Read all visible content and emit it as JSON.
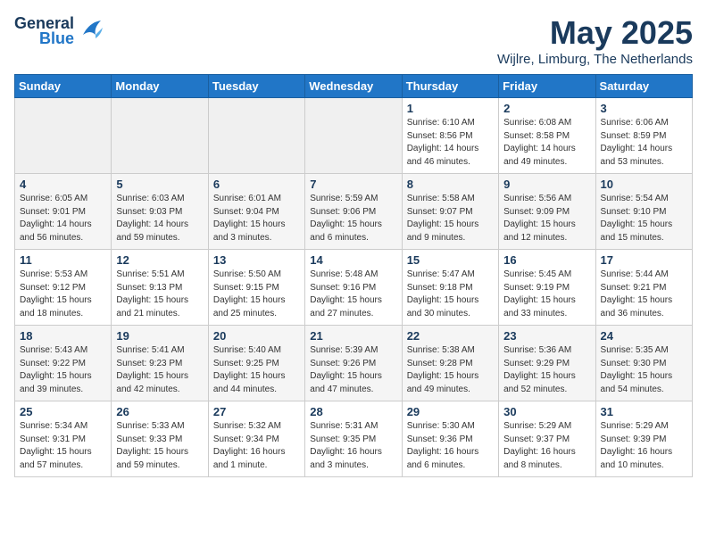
{
  "header": {
    "logo_line1": "General",
    "logo_line2": "Blue",
    "month_title": "May 2025",
    "location": "Wijlre, Limburg, The Netherlands"
  },
  "days_of_week": [
    "Sunday",
    "Monday",
    "Tuesday",
    "Wednesday",
    "Thursday",
    "Friday",
    "Saturday"
  ],
  "weeks": [
    [
      {
        "day": "",
        "info": ""
      },
      {
        "day": "",
        "info": ""
      },
      {
        "day": "",
        "info": ""
      },
      {
        "day": "",
        "info": ""
      },
      {
        "day": "1",
        "info": "Sunrise: 6:10 AM\nSunset: 8:56 PM\nDaylight: 14 hours\nand 46 minutes."
      },
      {
        "day": "2",
        "info": "Sunrise: 6:08 AM\nSunset: 8:58 PM\nDaylight: 14 hours\nand 49 minutes."
      },
      {
        "day": "3",
        "info": "Sunrise: 6:06 AM\nSunset: 8:59 PM\nDaylight: 14 hours\nand 53 minutes."
      }
    ],
    [
      {
        "day": "4",
        "info": "Sunrise: 6:05 AM\nSunset: 9:01 PM\nDaylight: 14 hours\nand 56 minutes."
      },
      {
        "day": "5",
        "info": "Sunrise: 6:03 AM\nSunset: 9:03 PM\nDaylight: 14 hours\nand 59 minutes."
      },
      {
        "day": "6",
        "info": "Sunrise: 6:01 AM\nSunset: 9:04 PM\nDaylight: 15 hours\nand 3 minutes."
      },
      {
        "day": "7",
        "info": "Sunrise: 5:59 AM\nSunset: 9:06 PM\nDaylight: 15 hours\nand 6 minutes."
      },
      {
        "day": "8",
        "info": "Sunrise: 5:58 AM\nSunset: 9:07 PM\nDaylight: 15 hours\nand 9 minutes."
      },
      {
        "day": "9",
        "info": "Sunrise: 5:56 AM\nSunset: 9:09 PM\nDaylight: 15 hours\nand 12 minutes."
      },
      {
        "day": "10",
        "info": "Sunrise: 5:54 AM\nSunset: 9:10 PM\nDaylight: 15 hours\nand 15 minutes."
      }
    ],
    [
      {
        "day": "11",
        "info": "Sunrise: 5:53 AM\nSunset: 9:12 PM\nDaylight: 15 hours\nand 18 minutes."
      },
      {
        "day": "12",
        "info": "Sunrise: 5:51 AM\nSunset: 9:13 PM\nDaylight: 15 hours\nand 21 minutes."
      },
      {
        "day": "13",
        "info": "Sunrise: 5:50 AM\nSunset: 9:15 PM\nDaylight: 15 hours\nand 25 minutes."
      },
      {
        "day": "14",
        "info": "Sunrise: 5:48 AM\nSunset: 9:16 PM\nDaylight: 15 hours\nand 27 minutes."
      },
      {
        "day": "15",
        "info": "Sunrise: 5:47 AM\nSunset: 9:18 PM\nDaylight: 15 hours\nand 30 minutes."
      },
      {
        "day": "16",
        "info": "Sunrise: 5:45 AM\nSunset: 9:19 PM\nDaylight: 15 hours\nand 33 minutes."
      },
      {
        "day": "17",
        "info": "Sunrise: 5:44 AM\nSunset: 9:21 PM\nDaylight: 15 hours\nand 36 minutes."
      }
    ],
    [
      {
        "day": "18",
        "info": "Sunrise: 5:43 AM\nSunset: 9:22 PM\nDaylight: 15 hours\nand 39 minutes."
      },
      {
        "day": "19",
        "info": "Sunrise: 5:41 AM\nSunset: 9:23 PM\nDaylight: 15 hours\nand 42 minutes."
      },
      {
        "day": "20",
        "info": "Sunrise: 5:40 AM\nSunset: 9:25 PM\nDaylight: 15 hours\nand 44 minutes."
      },
      {
        "day": "21",
        "info": "Sunrise: 5:39 AM\nSunset: 9:26 PM\nDaylight: 15 hours\nand 47 minutes."
      },
      {
        "day": "22",
        "info": "Sunrise: 5:38 AM\nSunset: 9:28 PM\nDaylight: 15 hours\nand 49 minutes."
      },
      {
        "day": "23",
        "info": "Sunrise: 5:36 AM\nSunset: 9:29 PM\nDaylight: 15 hours\nand 52 minutes."
      },
      {
        "day": "24",
        "info": "Sunrise: 5:35 AM\nSunset: 9:30 PM\nDaylight: 15 hours\nand 54 minutes."
      }
    ],
    [
      {
        "day": "25",
        "info": "Sunrise: 5:34 AM\nSunset: 9:31 PM\nDaylight: 15 hours\nand 57 minutes."
      },
      {
        "day": "26",
        "info": "Sunrise: 5:33 AM\nSunset: 9:33 PM\nDaylight: 15 hours\nand 59 minutes."
      },
      {
        "day": "27",
        "info": "Sunrise: 5:32 AM\nSunset: 9:34 PM\nDaylight: 16 hours\nand 1 minute."
      },
      {
        "day": "28",
        "info": "Sunrise: 5:31 AM\nSunset: 9:35 PM\nDaylight: 16 hours\nand 3 minutes."
      },
      {
        "day": "29",
        "info": "Sunrise: 5:30 AM\nSunset: 9:36 PM\nDaylight: 16 hours\nand 6 minutes."
      },
      {
        "day": "30",
        "info": "Sunrise: 5:29 AM\nSunset: 9:37 PM\nDaylight: 16 hours\nand 8 minutes."
      },
      {
        "day": "31",
        "info": "Sunrise: 5:29 AM\nSunset: 9:39 PM\nDaylight: 16 hours\nand 10 minutes."
      }
    ]
  ]
}
